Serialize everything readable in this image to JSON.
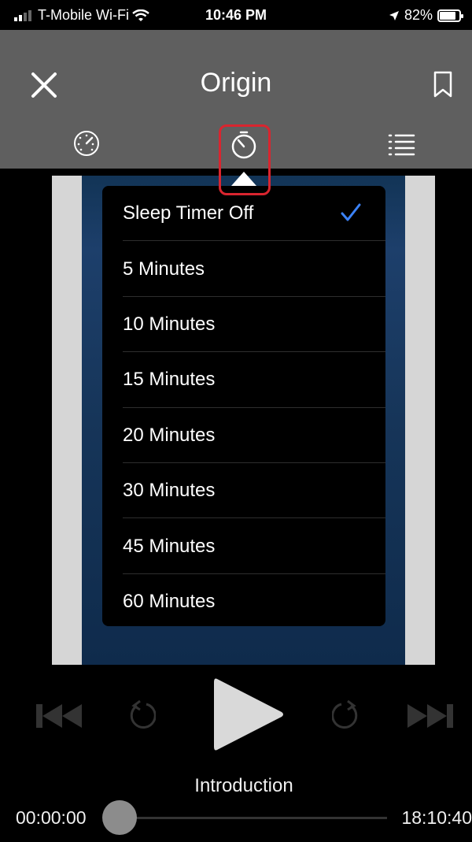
{
  "status_bar": {
    "carrier": "T-Mobile Wi-Fi",
    "time": "10:46 PM",
    "battery": "82%",
    "battery_level": 0.82
  },
  "header": {
    "title": "Origin",
    "icons": {
      "close": "close-icon",
      "bookmark": "bookmark-icon",
      "speed": "playback-speed-icon",
      "timer": "sleep-timer-icon",
      "chapters": "chapter-list-icon"
    }
  },
  "sleep_timer_menu": {
    "items": [
      {
        "label": "Sleep Timer Off",
        "selected": true
      },
      {
        "label": "5 Minutes",
        "selected": false
      },
      {
        "label": "10 Minutes",
        "selected": false
      },
      {
        "label": "15 Minutes",
        "selected": false
      },
      {
        "label": "20 Minutes",
        "selected": false
      },
      {
        "label": "30 Minutes",
        "selected": false
      },
      {
        "label": "45 Minutes",
        "selected": false
      },
      {
        "label": "60 Minutes",
        "selected": false
      }
    ],
    "check_color": "#3b82f6"
  },
  "player": {
    "chapter": "Introduction",
    "elapsed": "00:00:00",
    "remaining": "18:10:40",
    "progress": 0.0
  },
  "colors": {
    "header_bg": "#5f5f5f",
    "highlight": "#d9252f"
  }
}
